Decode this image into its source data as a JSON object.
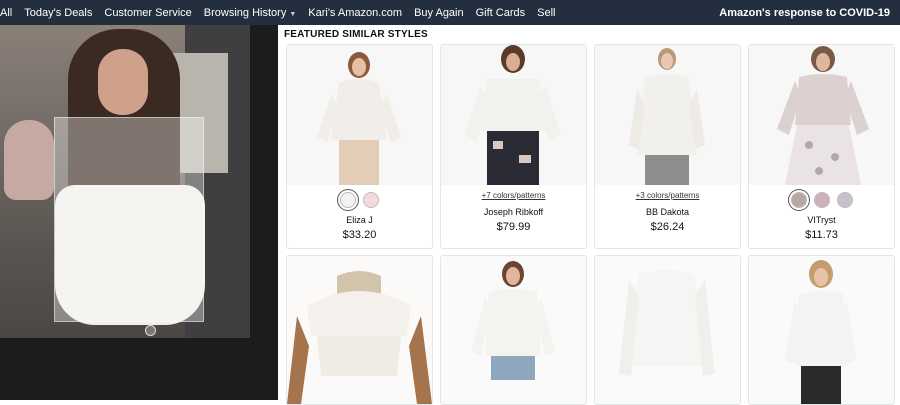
{
  "nav": {
    "items": [
      "All",
      "Today's Deals",
      "Customer Service",
      "Browsing History",
      "Kari's Amazon.com",
      "Buy Again",
      "Gift Cards",
      "Sell"
    ],
    "right": "Amazon's response to COVID-19"
  },
  "section": {
    "title": "FEATURED SIMILAR STYLES"
  },
  "products": [
    {
      "brand": "Eliza J",
      "price": "$33.20",
      "swatches": [
        "#f4f2f0",
        "#f2d9dc"
      ],
      "more": ""
    },
    {
      "brand": "Joseph Ribkoff",
      "price": "$79.99",
      "swatches": [],
      "more": "+7 colors/patterns"
    },
    {
      "brand": "BB Dakota",
      "price": "$26.24",
      "swatches": [],
      "more": "+3 colors/patterns"
    },
    {
      "brand": "VITryst",
      "price": "$11.73",
      "swatches": [
        "#b9a7a6",
        "#cfb1bb",
        "#c9c0ce"
      ],
      "more": ""
    },
    {
      "brand": "",
      "price": "",
      "swatches": [],
      "more": ""
    },
    {
      "brand": "",
      "price": "",
      "swatches": [],
      "more": ""
    },
    {
      "brand": "",
      "price": "",
      "swatches": [],
      "more": ""
    },
    {
      "brand": "",
      "price": "",
      "swatches": [],
      "more": ""
    }
  ],
  "icons": {
    "nav_caret": "chevron-down-icon",
    "image_dot": "carousel-dot-icon"
  },
  "colors": {
    "nav_bg": "#232f3e",
    "viewer_bg": "#1c1c1c"
  }
}
